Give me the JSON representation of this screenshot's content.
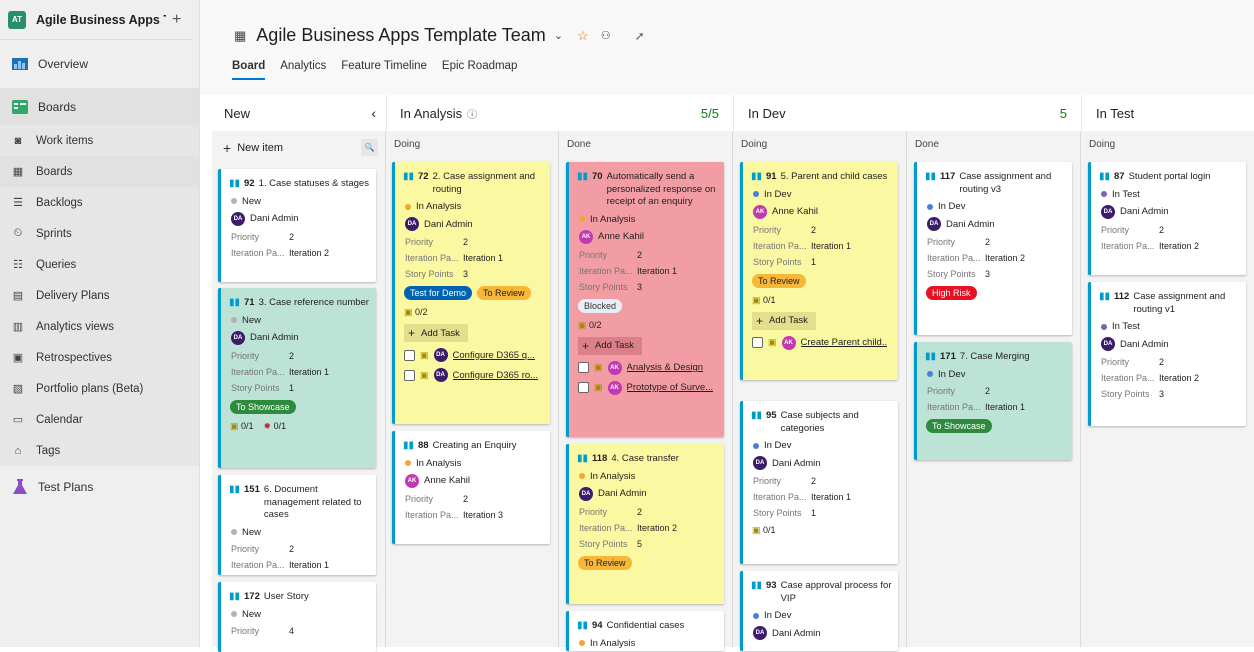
{
  "project": {
    "initials": "AT",
    "name": "Agile Business Apps Te...",
    "plus": "+"
  },
  "nav": [
    {
      "label": "Overview",
      "icon": "overview-icon"
    },
    {
      "label": "Boards",
      "icon": "boards-icon"
    },
    {
      "label": "Work items",
      "icon": "work-items-icon"
    },
    {
      "label": "Boards",
      "icon": "board-icon"
    },
    {
      "label": "Backlogs",
      "icon": "backlogs-icon"
    },
    {
      "label": "Sprints",
      "icon": "sprints-icon"
    },
    {
      "label": "Queries",
      "icon": "queries-icon"
    },
    {
      "label": "Delivery Plans",
      "icon": "delivery-plans-icon"
    },
    {
      "label": "Analytics views",
      "icon": "analytics-views-icon"
    },
    {
      "label": "Retrospectives",
      "icon": "retrospectives-icon"
    },
    {
      "label": "Portfolio plans (Beta)",
      "icon": "portfolio-plans-icon"
    },
    {
      "label": "Calendar",
      "icon": "calendar-icon"
    },
    {
      "label": "Tags",
      "icon": "tags-icon"
    },
    {
      "label": "Test Plans",
      "icon": "test-plans-icon"
    }
  ],
  "header": {
    "title": "Agile Business Apps Template Team",
    "tabs": [
      "Board",
      "Analytics",
      "Feature Timeline",
      "Epic Roadmap"
    ]
  },
  "columns": {
    "new": {
      "title": "New",
      "collapse": "‹",
      "new_item": "New item"
    },
    "in_analysis": {
      "title": "In Analysis",
      "wip": "5/5",
      "doing": "Doing",
      "done": "Done"
    },
    "in_dev": {
      "title": "In Dev",
      "wip": "5",
      "doing": "Doing",
      "done": "Done"
    },
    "in_test": {
      "title": "In Test",
      "doing": "Doing"
    }
  },
  "labels": {
    "priority": "Priority",
    "iteration": "Iteration Pa...",
    "story_points": "Story Points",
    "add_task": "Add Task"
  },
  "colors": {
    "new": "#b2b2b2",
    "analysis": "#f2a72e",
    "dev": "#4a7ed9",
    "test": "#7b61b4",
    "accent": "#0078d4",
    "wip": "#107c10"
  },
  "cards": {
    "c92": {
      "id": "92",
      "title": "1. Case statuses & stages",
      "state": "New",
      "assignee": "Dani Admin",
      "initials": "DA",
      "priority": "2",
      "iteration": "Iteration 2"
    },
    "c71": {
      "id": "71",
      "title": "3. Case reference number",
      "state": "New",
      "assignee": "Dani Admin",
      "initials": "DA",
      "priority": "2",
      "iteration": "Iteration 1",
      "points": "1",
      "tag": "To Showcase",
      "tasks": "0/1",
      "bugs": "0/1"
    },
    "c151": {
      "id": "151",
      "title": "6. Document management related to cases",
      "state": "New",
      "priority": "2",
      "iteration": "Iteration 1"
    },
    "c172": {
      "id": "172",
      "title": "User Story",
      "state": "New",
      "priority": "4"
    },
    "c72": {
      "id": "72",
      "title": "2. Case assignment and routing",
      "state": "In Analysis",
      "assignee": "Dani Admin",
      "initials": "DA",
      "priority": "2",
      "iteration": "Iteration 1",
      "points": "3",
      "tag1": "Test for Demo",
      "tag2": "To Review",
      "tasks": "0/2",
      "task1": "Configure D365 q...",
      "task2": "Configure D365 ro..."
    },
    "c88": {
      "id": "88",
      "title": "Creating an Enquiry",
      "state": "In Analysis",
      "assignee": "Anne Kahil",
      "initials": "AK",
      "priority": "2",
      "iteration": "Iteration 3"
    },
    "c70": {
      "id": "70",
      "title": "Automatically send a personalized response on receipt of an enquiry",
      "state": "In Analysis",
      "assignee": "Anne Kahil",
      "initials": "AK",
      "priority": "2",
      "iteration": "Iteration 1",
      "points": "3",
      "tag": "Blocked",
      "tasks": "0/2",
      "task1": "Analysis & Design",
      "task2": "Prototype of Surve..."
    },
    "c118": {
      "id": "118",
      "title": "4. Case transfer",
      "state": "In Analysis",
      "assignee": "Dani Admin",
      "initials": "DA",
      "priority": "2",
      "iteration": "Iteration 2",
      "points": "5",
      "tag": "To Review"
    },
    "c94": {
      "id": "94",
      "title": "Confidential cases",
      "state": "In Analysis"
    },
    "c91": {
      "id": "91",
      "title": "5. Parent and child cases",
      "state": "In Dev",
      "assignee": "Anne Kahil",
      "initials": "AK",
      "priority": "2",
      "iteration": "Iteration 1",
      "points": "1",
      "tag": "To Review",
      "tasks": "0/1",
      "task1": "Create Parent child..."
    },
    "c95": {
      "id": "95",
      "title": "Case subjects and categories",
      "state": "In Dev",
      "assignee": "Dani Admin",
      "initials": "DA",
      "priority": "2",
      "iteration": "Iteration 1",
      "points": "1",
      "tasks": "0/1"
    },
    "c93": {
      "id": "93",
      "title": "Case approval process for VIP",
      "state": "In Dev",
      "assignee": "Dani Admin",
      "initials": "DA"
    },
    "c117": {
      "id": "117",
      "title": "Case assignment and routing v3",
      "state": "In Dev",
      "assignee": "Dani Admin",
      "initials": "DA",
      "priority": "2",
      "iteration": "Iteration 2",
      "points": "3",
      "tag": "High Risk"
    },
    "c171": {
      "id": "171",
      "title": "7. Case Merging",
      "state": "In Dev",
      "priority": "2",
      "iteration": "Iteration 1",
      "tag": "To Showcase"
    },
    "c87": {
      "id": "87",
      "title": "Student portal login",
      "state": "In Test",
      "assignee": "Dani Admin",
      "initials": "DA",
      "priority": "2",
      "iteration": "Iteration 2"
    },
    "c112": {
      "id": "112",
      "title": "Case assignment and routing v1",
      "state": "In Test",
      "assignee": "Dani Admin",
      "initials": "DA",
      "priority": "2",
      "iteration": "Iteration 2",
      "points": "3"
    }
  }
}
